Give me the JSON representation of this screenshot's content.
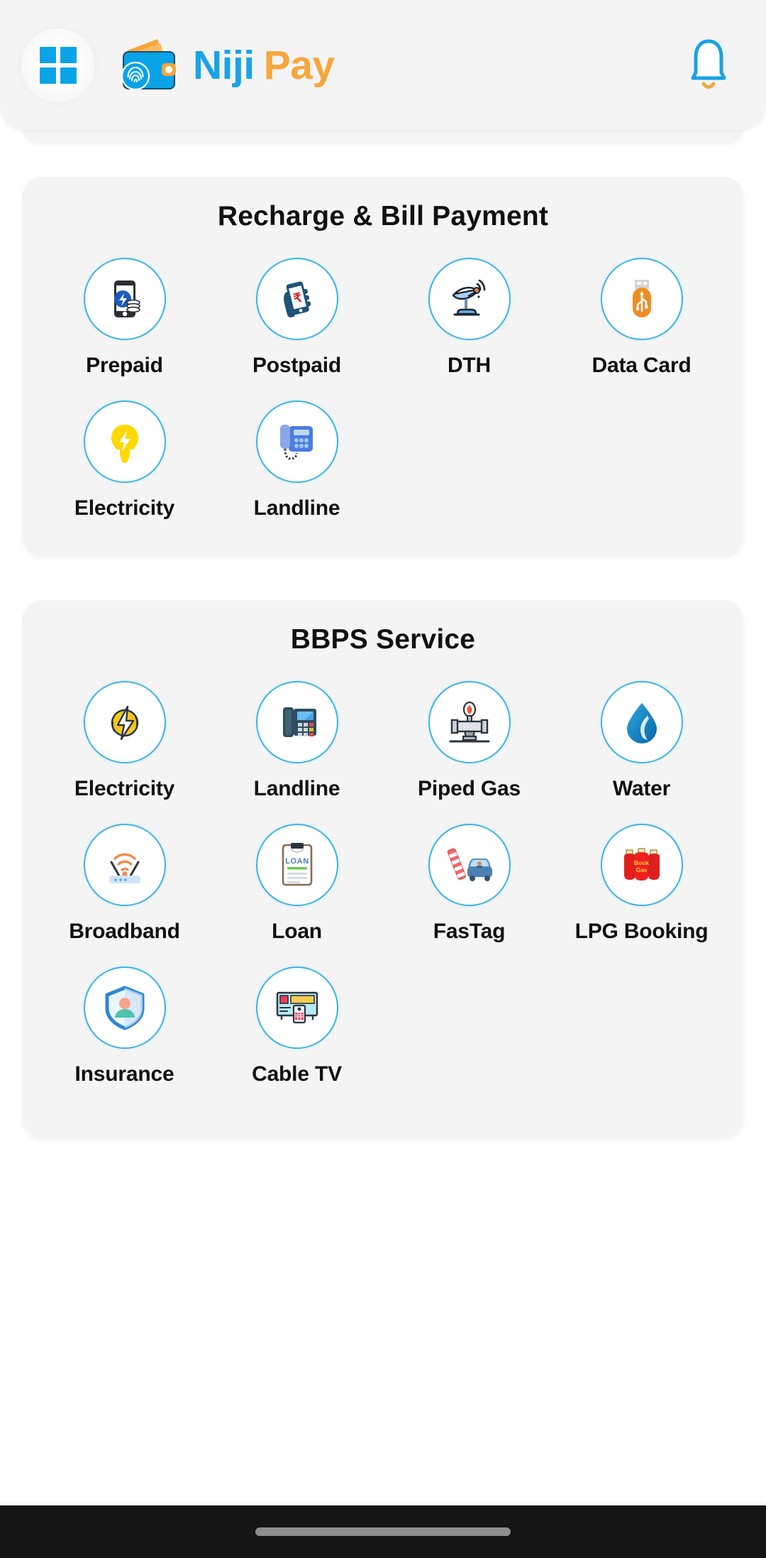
{
  "header": {
    "grid_icon": "grid-menu-icon",
    "brand_first": "Niji",
    "brand_second": "Pay",
    "wallet_icon": "wallet-fingerprint-logo",
    "notification_icon": "bell-icon"
  },
  "colors": {
    "brand_blue": "#19a3e5",
    "brand_orange": "#f6a63c",
    "ring_border": "#3cb4e5",
    "card_bg": "#f4f4f4",
    "page_bg": "#ffffff",
    "label_text": "#111111",
    "gesture_bar": "#151515"
  },
  "sections": [
    {
      "title": "Recharge & Bill Payment",
      "items": [
        {
          "label": "Prepaid",
          "icon": "mobile-recharge-icon"
        },
        {
          "label": "Postpaid",
          "icon": "hand-phone-rupee-icon"
        },
        {
          "label": "DTH",
          "icon": "satellite-dish-icon"
        },
        {
          "label": "Data Card",
          "icon": "usb-datacard-icon"
        },
        {
          "label": "Electricity",
          "icon": "lightbulb-icon"
        },
        {
          "label": "Landline",
          "icon": "desk-phone-icon"
        }
      ]
    },
    {
      "title": "BBPS Service",
      "items": [
        {
          "label": "Electricity",
          "icon": "lightning-bolt-circle-icon"
        },
        {
          "label": "Landline",
          "icon": "office-telephone-icon"
        },
        {
          "label": "Piped Gas",
          "icon": "gas-pipe-flame-icon"
        },
        {
          "label": "Water",
          "icon": "water-drop-icon"
        },
        {
          "label": "Broadband",
          "icon": "wifi-router-icon"
        },
        {
          "label": "Loan",
          "icon": "loan-clipboard-icon"
        },
        {
          "label": "FasTag",
          "icon": "fastag-toll-car-icon"
        },
        {
          "label": "LPG Booking",
          "icon": "lpg-cylinders-icon"
        },
        {
          "label": "Insurance",
          "icon": "shield-person-icon"
        },
        {
          "label": "Cable TV",
          "icon": "cable-tv-box-icon"
        }
      ]
    }
  ],
  "loan_icon_text": "LOAN",
  "lpg_icon_text": "Book Gas",
  "gesture_bar": "home-indicator"
}
